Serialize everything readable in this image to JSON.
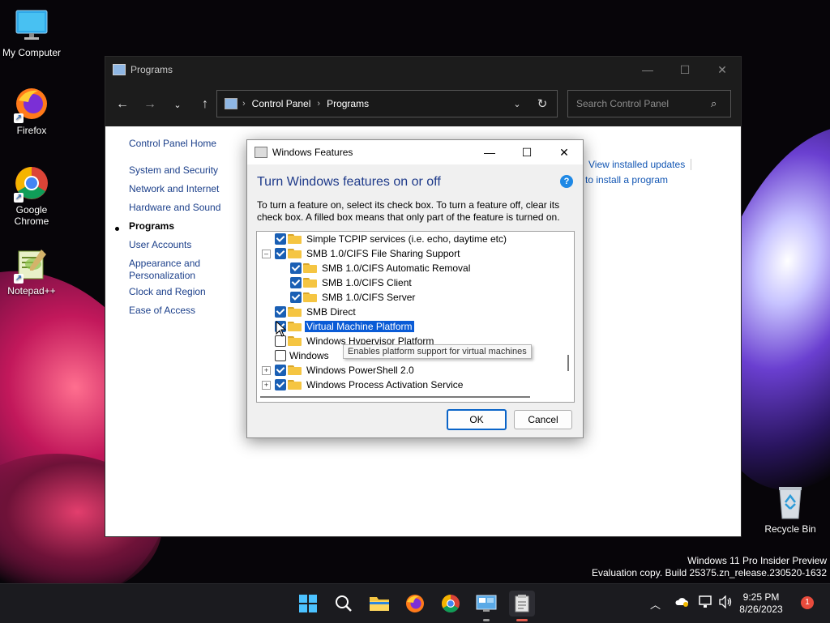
{
  "desktop": {
    "icons": [
      {
        "label": "My Computer"
      },
      {
        "label": "Firefox"
      },
      {
        "label": "Google Chrome"
      },
      {
        "label": "Notepad++"
      },
      {
        "label": "Recycle Bin"
      }
    ]
  },
  "window": {
    "title": "Programs",
    "address": {
      "root": "Control Panel",
      "current": "Programs"
    },
    "search_placeholder": "Search Control Panel",
    "sidebar": [
      {
        "label": "Control Panel Home"
      },
      {
        "label": "System and Security"
      },
      {
        "label": "Network and Internet"
      },
      {
        "label": "Hardware and Sound"
      },
      {
        "label": "Programs",
        "current": true
      },
      {
        "label": "User Accounts"
      },
      {
        "label": "Appearance and Personalization"
      },
      {
        "label": "Clock and Region"
      },
      {
        "label": "Ease of Access"
      }
    ],
    "main_links": {
      "installed_updates": "View installed updates",
      "install_program": "w to install a program"
    }
  },
  "dialog": {
    "title": "Windows Features",
    "heading": "Turn Windows features on or off",
    "help": "?",
    "description": "To turn a feature on, select its check box. To turn a feature off, clear its check box. A filled box means that only part of the feature is turned on.",
    "features": [
      {
        "label": "Simple TCPIP services (i.e. echo, daytime etc)",
        "checked": true
      },
      {
        "label": "SMB 1.0/CIFS File Sharing Support",
        "checked": true,
        "expander": "–"
      },
      {
        "label": "SMB 1.0/CIFS Automatic Removal",
        "checked": true
      },
      {
        "label": "SMB 1.0/CIFS Client",
        "checked": true
      },
      {
        "label": "SMB 1.0/CIFS Server",
        "checked": true
      },
      {
        "label": "SMB Direct",
        "checked": true
      },
      {
        "label": "Virtual Machine Platform",
        "checked": true,
        "selected": true
      },
      {
        "label": "Windows Hypervisor Platform",
        "checked": false
      },
      {
        "label": "Windows",
        "checked": false
      },
      {
        "label": "Windows PowerShell 2.0",
        "checked": true,
        "expander": "+"
      },
      {
        "label": "Windows Process Activation Service",
        "checked": true,
        "expander": "+"
      }
    ],
    "tooltip": "Enables platform support for virtual machines",
    "ok_label": "OK",
    "cancel_label": "Cancel"
  },
  "os_build": {
    "line1": "Windows 11 Pro Insider Preview",
    "line2": "Evaluation copy. Build 25375.zn_release.230520-1632"
  },
  "taskbar": {
    "time": "9:25 PM",
    "date": "8/26/2023",
    "notification_count": "1"
  },
  "colors": {
    "accent": "#0a5bd6",
    "link": "#1155b3",
    "heading": "#1e3a8a"
  }
}
